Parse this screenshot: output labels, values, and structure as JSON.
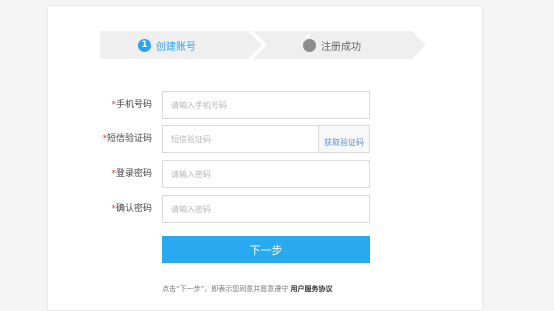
{
  "steps": [
    {
      "number": "1",
      "label": "创建账号",
      "active": true
    },
    {
      "label": "注册成功",
      "active": false
    }
  ],
  "form": {
    "phone": {
      "label": "手机号码",
      "placeholder": "请输入手机号码"
    },
    "sms_code": {
      "label": "短信验证码",
      "placeholder": "短信验证码",
      "button": "获取验证码"
    },
    "password": {
      "label": "登录密码",
      "placeholder": "请输入密码"
    },
    "confirm_password": {
      "label": "确认密码",
      "placeholder": "请输入密码"
    },
    "required_mark": "*"
  },
  "next_button": "下一步",
  "agreement": {
    "text": "点击“下一步”，即表示您同意并愿意遵守",
    "link": "用户服务协议"
  },
  "colors": {
    "accent": "#29a9f0",
    "required": "#e53935",
    "step_bg": "#efefef"
  }
}
